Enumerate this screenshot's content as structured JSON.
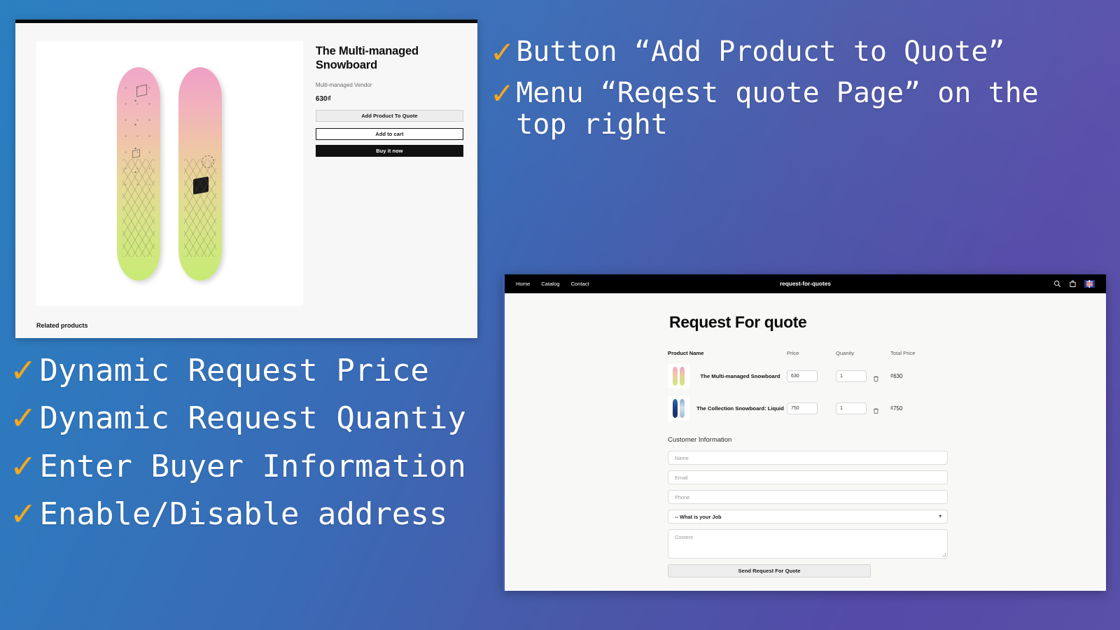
{
  "background": {
    "gradient_from": "#2a7fc0",
    "gradient_mid": "#4a57a8",
    "gradient_to": "#5950a8",
    "accent_tick_color": "#f7a81b"
  },
  "product_page": {
    "title": "The Multi-managed Snowboard",
    "vendor": "Multi-managed Vendor",
    "price": "630₫",
    "buttons": {
      "add_to_quote": "Add Product To Quote",
      "add_to_cart": "Add to cart",
      "buy_it_now": "Buy it now"
    },
    "related_heading": "Related products",
    "gallery": {
      "board_front": "snowboard-front-pink-yellow",
      "board_back": "snowboard-back-pink-yellow"
    }
  },
  "annotations_right": [
    {
      "tick": "✓",
      "text": "Button “Add Product to Quote”"
    },
    {
      "tick": "✓",
      "text": "Menu “Reqest quote Page” on the top right"
    }
  ],
  "annotations_left": [
    {
      "tick": "✓",
      "text": "Dynamic Request Price"
    },
    {
      "tick": "✓",
      "text": "Dynamic Request Quantiy"
    },
    {
      "tick": "✓",
      "text": "Enter Buyer Information"
    },
    {
      "tick": "✓",
      "text": "Enable/Disable address"
    }
  ],
  "rfq_page": {
    "nav": [
      {
        "label": "Home"
      },
      {
        "label": "Catalog"
      },
      {
        "label": "Contact"
      }
    ],
    "brand": "request-for-quotes",
    "header_icons": [
      {
        "name": "search-icon"
      },
      {
        "name": "cart-icon"
      },
      {
        "name": "flag-language-icon"
      }
    ],
    "page_title": "Request For quote",
    "table": {
      "columns": [
        "Product Name",
        "Price",
        "Quanity",
        "Total Price"
      ],
      "rows": [
        {
          "thumb": "snowboard-pink-thumb",
          "name": "The Multi-managed Snowboard",
          "price": "630",
          "quantity": "1",
          "total": "₫630",
          "delete_icon": "trash-icon"
        },
        {
          "thumb": "snowboard-blue-thumb",
          "name": "The Collection Snowboard: Liquid",
          "price": "750",
          "quantity": "1",
          "total": "₫750",
          "delete_icon": "trash-icon"
        }
      ]
    },
    "customer_section_heading": "Customer Information",
    "fields": {
      "name_placeholder": "Name",
      "email_placeholder": "Email",
      "phone_placeholder": "Phone",
      "job_selected": "-- What is your Job",
      "content_placeholder": "Content"
    },
    "submit_label": "Send Request For Quote"
  }
}
